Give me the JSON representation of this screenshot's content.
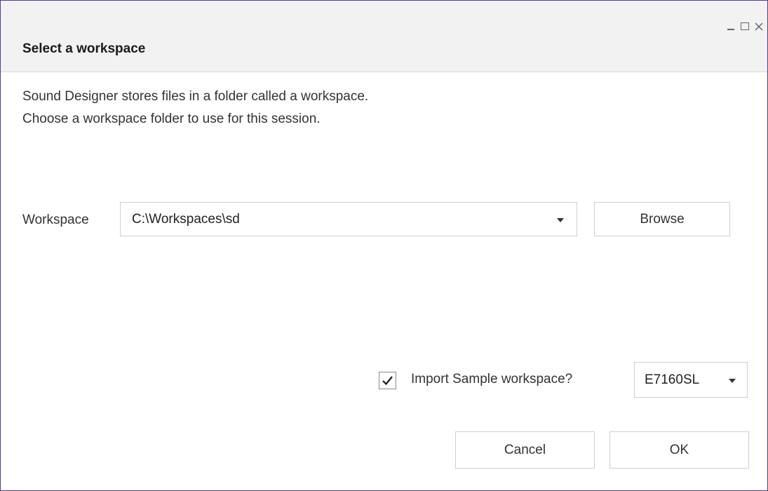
{
  "dialog": {
    "title": "Select a workspace",
    "description_line1": "Sound Designer stores files in a folder called a workspace.",
    "description_line2": "Choose a workspace folder to use for this session.",
    "window_controls": [
      "minimize-icon",
      "maximize-icon",
      "close-icon"
    ]
  },
  "workspace": {
    "label": "Workspace",
    "selected_value": "C:\\Workspaces\\sd",
    "browse_label": "Browse"
  },
  "import_sample": {
    "checked": true,
    "label": "Import Sample workspace?",
    "selected_value": "E7160SL"
  },
  "actions": {
    "cancel_label": "Cancel",
    "ok_label": "OK"
  },
  "colors": {
    "window_border": "#5b3a8c",
    "header_background": "#f2f2f2",
    "control_border": "#cfcfcf"
  }
}
